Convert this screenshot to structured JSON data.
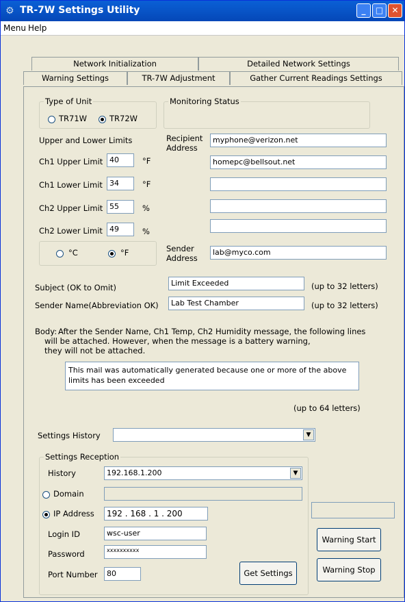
{
  "window": {
    "title": "TR-7W Settings Utility"
  },
  "menu": {
    "items": [
      "Menu",
      "Help"
    ]
  },
  "tabs": {
    "row1": [
      "Network Initialization",
      "Detailed Network Settings"
    ],
    "row2": [
      "Warning Settings",
      "TR-7W Adjustment",
      "Gather Current Readings Settings"
    ]
  },
  "unit_type": {
    "legend": "Type of Unit",
    "opt1": "TR71W",
    "opt2": "TR72W",
    "selected": "TR72W"
  },
  "monitoring": {
    "legend": "Monitoring Status"
  },
  "limits": {
    "heading": "Upper and Lower Limits",
    "ch1_upper": {
      "label": "Ch1 Upper Limit",
      "value": "40",
      "unit": "°F"
    },
    "ch1_lower": {
      "label": "Ch1 Lower Limit",
      "value": "34",
      "unit": "°F"
    },
    "ch2_upper": {
      "label": "Ch2 Upper Limit",
      "value": "55",
      "unit": "%"
    },
    "ch2_lower": {
      "label": "Ch2 Lower Limit",
      "value": "49",
      "unit": "%"
    }
  },
  "temp_unit": {
    "c": "°C",
    "f": "°F",
    "selected": "°F"
  },
  "recipient": {
    "label1": "Recipient",
    "label2": "Address",
    "values": [
      "myphone@verizon.net",
      "homepc@bellsout.net",
      "",
      "",
      ""
    ]
  },
  "sender": {
    "label1": "Sender",
    "label2": "Address",
    "value": "lab@myco.com"
  },
  "subject": {
    "label": "Subject (OK to Omit)",
    "value": "Limit Exceeded",
    "note": "(up to 32 letters)"
  },
  "sender_name": {
    "label": "Sender Name(Abbreviation OK)",
    "value": "Lab Test Chamber",
    "note": "(up to 32 letters)"
  },
  "body": {
    "label": "Body:",
    "line1": "After the Sender Name, Ch1 Temp, Ch2 Humidity message, the following lines",
    "line2": "will be attached. However, when the message is a battery warning,",
    "line3": "they will not be attached.",
    "value": "This mail was automatically generated because one or more of the above limits has been exceeded",
    "note": "(up to 64 letters)"
  },
  "history": {
    "label": "Settings History",
    "value": ""
  },
  "reception": {
    "legend": "Settings Reception",
    "history_label": "History",
    "history_value": "192.168.1.200",
    "domain_label": "Domain",
    "domain_value": "",
    "ip_label": "IP Address",
    "ip_value": "192 . 168 .  1  . 200",
    "selected": "IP Address",
    "login_label": "Login ID",
    "login_value": "wsc-user",
    "password_label": "Password",
    "password_value": "xxxxxxxxxx",
    "port_label": "Port Number",
    "port_value": "80",
    "get_button": "Get Settings"
  },
  "status_box": {
    "value": ""
  },
  "warning_start": "Warning Start",
  "warning_stop": "Warning Stop",
  "colors": {
    "titlebar": "#0854c7",
    "face": "#ece9d8",
    "close": "#e0532f"
  }
}
